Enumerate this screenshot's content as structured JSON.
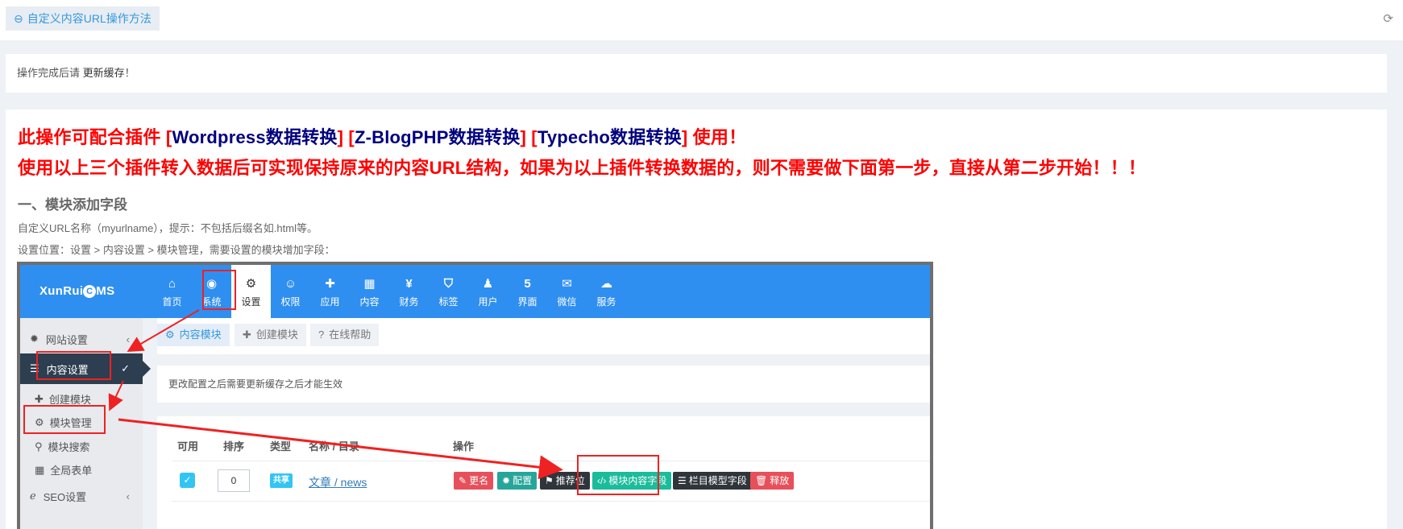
{
  "page_tab": {
    "icon": "link-icon",
    "label": "自定义内容URL操作方法"
  },
  "reload": {
    "icon": "refresh-icon"
  },
  "notice": {
    "prefix": "操作完成后请",
    "action": "更新缓存",
    "suffix": "！"
  },
  "headline": {
    "line1": {
      "intro": "此操作可配合插件 ",
      "plugins": [
        "Wordpress数据转换",
        "Z-BlogPHP数据转换",
        "Typecho数据转换"
      ],
      "outro": " 使用！"
    },
    "line2": "使用以上三个插件转入数据后可实现保持原来的内容URL结构，如果为以上插件转换数据的，则不需要做下面第一步，直接从第二步开始！！！"
  },
  "section": {
    "title": "一、模块添加字段",
    "desc1": "自定义URL名称（myurlname），提示：不包括后缀名如.html等。",
    "desc2": "设置位置：设置 > 内容设置 > 模块管理，需要设置的模块增加字段："
  },
  "cms": {
    "logo": {
      "prefix": "XunRui",
      "mark": "C",
      "suffix": "MS"
    },
    "nav": [
      {
        "label": "首页",
        "icon": "home-icon",
        "glyph": "⌂"
      },
      {
        "label": "系统",
        "icon": "globe-icon",
        "glyph": "◉"
      },
      {
        "label": "设置",
        "icon": "cogs-icon",
        "glyph": "⚙",
        "active": true
      },
      {
        "label": "权限",
        "icon": "user-circle-icon",
        "glyph": "☺"
      },
      {
        "label": "应用",
        "icon": "puzzle-icon",
        "glyph": "✚"
      },
      {
        "label": "内容",
        "icon": "grid-icon",
        "glyph": "▦"
      },
      {
        "label": "财务",
        "icon": "yen-icon",
        "glyph": "¥"
      },
      {
        "label": "标签",
        "icon": "tag-icon",
        "glyph": "⛉"
      },
      {
        "label": "用户",
        "icon": "user-icon",
        "glyph": "♟"
      },
      {
        "label": "界面",
        "icon": "html5-icon",
        "glyph": "5"
      },
      {
        "label": "微信",
        "icon": "wechat-icon",
        "glyph": "✉"
      },
      {
        "label": "服务",
        "icon": "cloud-icon",
        "glyph": "☁"
      }
    ],
    "sidebar": {
      "website": "网站设置",
      "content": "内容设置",
      "sub": [
        "创建模块",
        "模块管理",
        "模块搜索",
        "全局表单"
      ],
      "seo": "SEO设置"
    },
    "tabs": [
      "内容模块",
      "创建模块",
      "在线帮助"
    ],
    "tip": "更改配置之后需要更新缓存之后才能生效",
    "table": {
      "headers": [
        "可用",
        "排序",
        "类型",
        "名称 / 目录",
        "操作"
      ],
      "row": {
        "enabled": true,
        "order": "0",
        "type": "共享",
        "name": "文章 / news",
        "actions": [
          "更名",
          "配置",
          "推荐位",
          "模块内容字段",
          "栏目模型字段",
          "释放"
        ]
      }
    }
  },
  "colors": {
    "accent": "#3598dc",
    "headline_red": "#ff0000",
    "headline_navy": "#000080",
    "cms_header": "#2f8ff0",
    "annotation_red": "#ee2222"
  }
}
